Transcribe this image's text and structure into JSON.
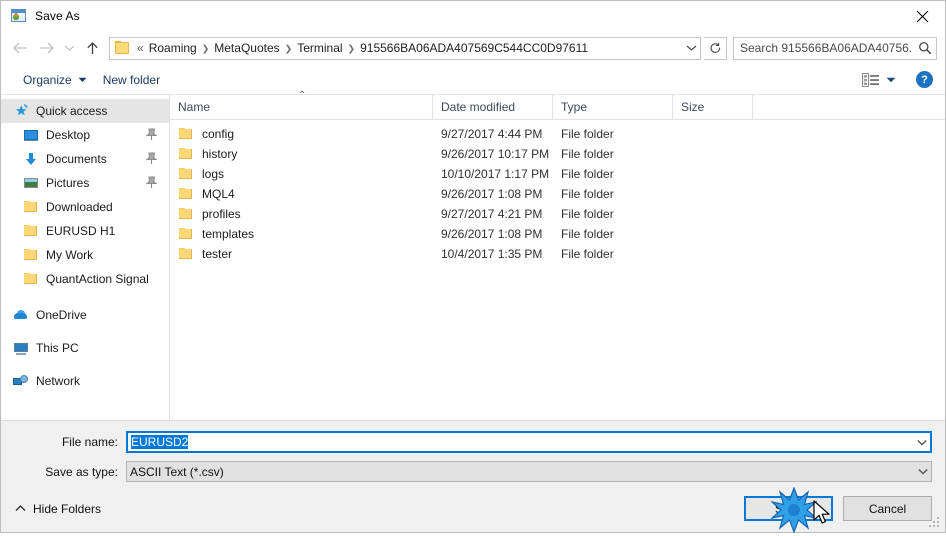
{
  "window": {
    "title": "Save As",
    "icon": "save-as-icon",
    "close_label": "✕"
  },
  "navigation": {
    "back_icon": "back-arrow-icon",
    "forward_icon": "forward-arrow-icon",
    "recent_icon": "chevron-down-icon",
    "up_icon": "up-arrow-icon",
    "refresh_icon": "refresh-icon",
    "dropdown_icon": "chevron-down-icon"
  },
  "address": {
    "folder_icon": "folder-icon",
    "leading_separator": "«",
    "crumbs": [
      "Roaming",
      "MetaQuotes",
      "Terminal",
      "915566BA06ADA407569C544CC0D97611"
    ],
    "separator": "❯"
  },
  "search": {
    "placeholder": "Search 915566BA06ADA40756...",
    "value": "",
    "icon": "search-icon"
  },
  "command_bar": {
    "organize_label": "Organize",
    "organize_caret": "▼",
    "new_folder_label": "New folder",
    "view_icon": "view-options-icon",
    "view_caret": "▼",
    "help_label": "?"
  },
  "sidebar": {
    "items": [
      {
        "label": "Quick access",
        "icon": "star-pin-icon",
        "selected": true,
        "indent": "root",
        "pinned": false
      },
      {
        "label": "Desktop",
        "icon": "desktop-icon",
        "selected": false,
        "indent": "child",
        "pinned": true
      },
      {
        "label": "Documents",
        "icon": "documents-icon",
        "selected": false,
        "indent": "child",
        "pinned": true
      },
      {
        "label": "Pictures",
        "icon": "pictures-icon",
        "selected": false,
        "indent": "child",
        "pinned": true
      },
      {
        "label": "Downloaded",
        "icon": "folder-icon",
        "selected": false,
        "indent": "child",
        "pinned": false
      },
      {
        "label": "EURUSD H1",
        "icon": "folder-icon",
        "selected": false,
        "indent": "child",
        "pinned": false
      },
      {
        "label": "My Work",
        "icon": "folder-icon",
        "selected": false,
        "indent": "child",
        "pinned": false
      },
      {
        "label": "QuantAction Signal",
        "icon": "folder-icon",
        "selected": false,
        "indent": "child",
        "pinned": false
      },
      {
        "label": "OneDrive",
        "icon": "onedrive-icon",
        "selected": false,
        "indent": "root",
        "pinned": false
      },
      {
        "label": "This PC",
        "icon": "this-pc-icon",
        "selected": false,
        "indent": "root",
        "pinned": false
      },
      {
        "label": "Network",
        "icon": "network-icon",
        "selected": false,
        "indent": "root",
        "pinned": false
      }
    ]
  },
  "file_list": {
    "columns": [
      "Name",
      "Date modified",
      "Type",
      "Size"
    ],
    "sort_indicator": "⌃",
    "rows": [
      {
        "name": "config",
        "date": "9/27/2017 4:44 PM",
        "type": "File folder",
        "size": ""
      },
      {
        "name": "history",
        "date": "9/26/2017 10:17 PM",
        "type": "File folder",
        "size": ""
      },
      {
        "name": "logs",
        "date": "10/10/2017 1:17 PM",
        "type": "File folder",
        "size": ""
      },
      {
        "name": "MQL4",
        "date": "9/26/2017 1:08 PM",
        "type": "File folder",
        "size": ""
      },
      {
        "name": "profiles",
        "date": "9/27/2017 4:21 PM",
        "type": "File folder",
        "size": ""
      },
      {
        "name": "templates",
        "date": "9/26/2017 1:08 PM",
        "type": "File folder",
        "size": ""
      },
      {
        "name": "tester",
        "date": "10/4/2017 1:35 PM",
        "type": "File folder",
        "size": ""
      }
    ]
  },
  "form": {
    "file_name_label": "File name:",
    "file_name_value": "EURUSD2",
    "save_as_type_label": "Save as type:",
    "save_as_type_value": "ASCII Text (*.csv)",
    "dropdown_icon": "chevron-down-icon"
  },
  "footer": {
    "hide_folders_label": "Hide Folders",
    "hide_folders_caret": "⌃",
    "save_label": "Save",
    "cancel_label": "Cancel",
    "resize_grip": "resize-grip-icon"
  },
  "colors": {
    "accent": "#0078d7",
    "selection": "#0078d7",
    "folder": "#fcd778",
    "crumb_text": "#1d1d1d",
    "panel": "#f0f0f0"
  }
}
